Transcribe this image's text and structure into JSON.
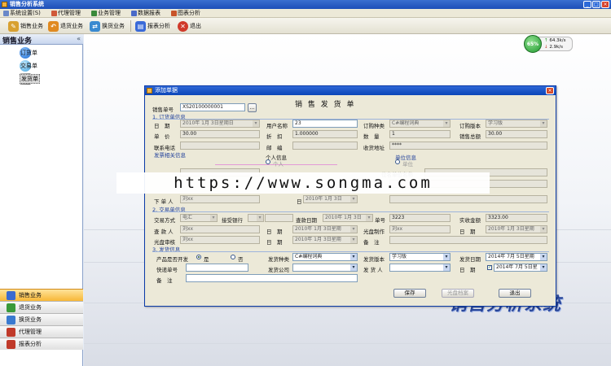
{
  "app": {
    "title": "销售分析系统"
  },
  "menu": [
    {
      "label": "系统设置(S)",
      "color": "#6a88c8"
    },
    {
      "label": "代理管理",
      "color": "#d05a3a"
    },
    {
      "label": "业务管理",
      "color": "#3a8a3a"
    },
    {
      "label": "数据报表",
      "color": "#4a6ac8"
    },
    {
      "label": "图表分析",
      "color": "#c8542a"
    }
  ],
  "toolbar": [
    {
      "label": "销售业务",
      "icon": "pen-icon",
      "color": "#d8a030",
      "glyph": "✎"
    },
    {
      "label": "退货业务",
      "icon": "return-icon",
      "color": "#e08a20",
      "glyph": "↶"
    },
    {
      "label": "换货业务",
      "icon": "exchange-icon",
      "color": "#3a8ad0",
      "glyph": "⇄"
    },
    {
      "label": "报表分析",
      "icon": "report-icon",
      "color": "#3a6ad8",
      "glyph": "▤"
    },
    {
      "label": "退出",
      "icon": "exit-icon",
      "color": "#d03a2a",
      "glyph": "✕"
    }
  ],
  "sidebar": {
    "title": "销售业务",
    "items": [
      {
        "label": "订货单",
        "icon": "order-icon",
        "color": "#2a7ad8"
      },
      {
        "label": "交易单",
        "icon": "deal-icon",
        "color": "#3aa0e0"
      },
      {
        "label": "发货单",
        "icon": "tools-icon",
        "color": "#7a7a7a"
      }
    ],
    "nav": [
      {
        "label": "销售业务",
        "icon": "sales-icon",
        "color": "#d8a030"
      },
      {
        "label": "退货业务",
        "icon": "return-icon",
        "color": "#3a9a3a"
      },
      {
        "label": "换货业务",
        "icon": "exchange-icon",
        "color": "#3a7ad0"
      },
      {
        "label": "代理管理",
        "icon": "agent-icon",
        "color": "#c03a2a"
      },
      {
        "label": "报表分析",
        "icon": "report-icon",
        "color": "#c03a2a"
      }
    ]
  },
  "desktop": {
    "brand": "销售分析系统",
    "netmon": {
      "percent": "65%",
      "up": "64.3k/s",
      "down": "2.9k/s"
    }
  },
  "dialog": {
    "title": "添加单据",
    "heading": "销 售 发 货 单",
    "order_no_label": "销售单号",
    "order_no": "XS20100000001",
    "sec1": "1. 订货单信息",
    "sec2": "2. 交易单信息",
    "sec3": "3. 发货信息",
    "f": {
      "date_l": "日　期",
      "date_v": "2010年 1月 3日星期日",
      "user_l": "用户名称",
      "user_v": "23",
      "kind_l": "订购种类",
      "kind_v": "C#编程词典",
      "ver_l": "订购版本",
      "ver_v": "学习版",
      "price_l": "单　价",
      "price_v": "30.00",
      "disc_l": "折　扣",
      "disc_v": "1.000000",
      "qty_l": "数　量",
      "qty_v": "1",
      "amt_l": "销售总额",
      "amt_v": "30.00",
      "tel_l": "联系电话",
      "mail_l": "邮　编",
      "addr_l": "收货地址",
      "addr_v": "****",
      "ship_info": "发票相关信息",
      "person_info": "个人信息",
      "unit_info": "单位信息",
      "radio_person": "个人",
      "radio_unit": "单位",
      "unit_name": "位名单位名称",
      "by_l": "下 单 人",
      "by_v": "刘xx",
      "day_l": "日",
      "day_v": "2010年 1月 3日",
      "trade_l": "交易方式",
      "trade_v": "电汇",
      "bank_l": "接受银行",
      "pay_date_l": "查款日期",
      "pay_date_v": "2010年 1月 3日",
      "no_l": "单号",
      "no_v": "3223",
      "recv_l": "实收金额",
      "recv_v": "3323.00",
      "payer_l": "查 款 人",
      "payer_v": "刘xx",
      "d1_l": "日　期",
      "d1_v": "2010年 1月 3日星期",
      "make_l": "光盘制作",
      "make_v": "刘xx",
      "d2_l": "日　期",
      "d2_v": "2010年 1月 3日星期",
      "audit_l": "光盘审核",
      "audit_v": "刘xx",
      "d3_l": "日　期",
      "d3_v": "2010年 1月 3日星期",
      "note_l": "备　注",
      "install_l": "产品是否开发",
      "yes": "是",
      "no": "否",
      "ship_kind_l": "发货种类",
      "ship_kind_v": "C#编程词典",
      "ship_ver_l": "发货版本",
      "ship_ver_v": "学习版",
      "ship_date_l": "发货日期",
      "ship_date_v": "2014年 7月 5日星期",
      "express_l": "快递单号",
      "company_l": "发货公司",
      "sender_l": "发 货 人",
      "d4_l": "日　期",
      "d4_v": "2014年 7月 5日星",
      "note2_l": "备　注"
    },
    "buttons": {
      "save": "保存",
      "print": "光盘档案",
      "exit": "退出"
    }
  },
  "watermark": "https://www.songma.com"
}
